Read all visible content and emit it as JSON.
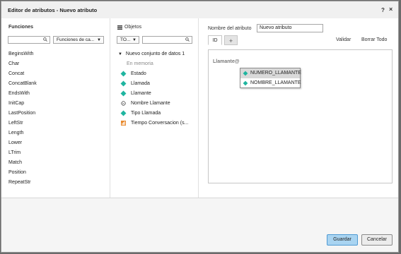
{
  "dialog": {
    "title": "Editor de atributos - Nuevo atributo",
    "help_label": "?",
    "close_label": "×"
  },
  "functions": {
    "title": "Funciones",
    "search_placeholder": "",
    "category_select": "Funciones de ca...",
    "items": [
      "BeginsWith",
      "Char",
      "Concat",
      "ConcatBlank",
      "EndsWith",
      "InitCap",
      "LastPosition",
      "LeftStr",
      "Length",
      "Lower",
      "LTrim",
      "Match",
      "Position",
      "RepeatStr"
    ]
  },
  "objects": {
    "title": "Objetos",
    "scope_select": "TO...",
    "search_placeholder": "",
    "tree": {
      "dataset": "Nuevo conjunto de datos 1",
      "group": "En memoria",
      "items": [
        "Estado",
        "Llamada",
        "Llamante",
        "Nombre Llamante",
        "Tipo Llamada",
        "Tiempo Conversacion (s..."
      ]
    }
  },
  "attribute": {
    "name_label": "Nombre del atributo",
    "name_value": "Nuevo atributo",
    "tabs": [
      "ID",
      "+"
    ],
    "validate_label": "Validar",
    "clear_label": "Borrar Todo",
    "expression": "Llamante@",
    "suggestions": [
      "NUMERO_LLAMANTE",
      "NOMBRE_LLAMANTE"
    ]
  },
  "footer": {
    "save_label": "Guardar",
    "cancel_label": "Cancelar"
  },
  "colors": {
    "primary_button": "#a9d4f1",
    "attribute_icon": "#1fb5a0",
    "metric_icon": "#e8892c"
  }
}
